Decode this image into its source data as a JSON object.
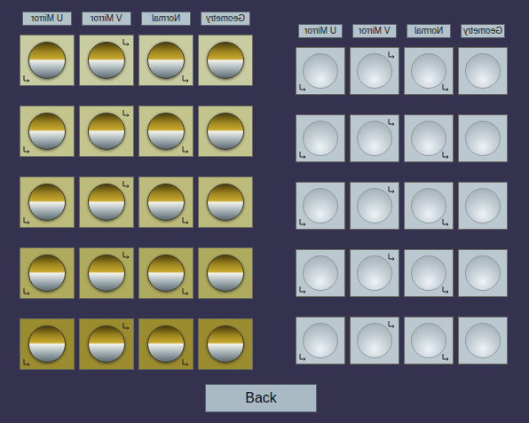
{
  "panels": [
    {
      "name": "gold",
      "kind": "gold",
      "headers": [
        {
          "label": "U Mirror",
          "mirrored": true
        },
        {
          "label": "V Mirror",
          "mirrored": true
        },
        {
          "label": "Normal",
          "mirrored": true
        },
        {
          "label": "Geometry",
          "mirrored": true
        }
      ],
      "rows": [
        {
          "color": "#c9cba0"
        },
        {
          "color": "#c4c48e"
        },
        {
          "color": "#bdbb7c"
        },
        {
          "color": "#aeaa5e"
        },
        {
          "color": "#9c8c30"
        }
      ]
    },
    {
      "name": "plain",
      "kind": "plain",
      "headers": [
        {
          "label": "U Mirror",
          "mirrored": true
        },
        {
          "label": "V Mirror",
          "mirrored": true
        },
        {
          "label": "Normal",
          "mirrored": true
        },
        {
          "label": "Geometry",
          "mirrored": true
        }
      ],
      "rows": [
        {
          "color": "#bcc8cf"
        },
        {
          "color": "#bcc8cf"
        },
        {
          "color": "#bcc8cf"
        },
        {
          "color": "#bcc8cf"
        },
        {
          "color": "#bcc8cf"
        }
      ]
    }
  ],
  "buttons": [
    "Back"
  ]
}
